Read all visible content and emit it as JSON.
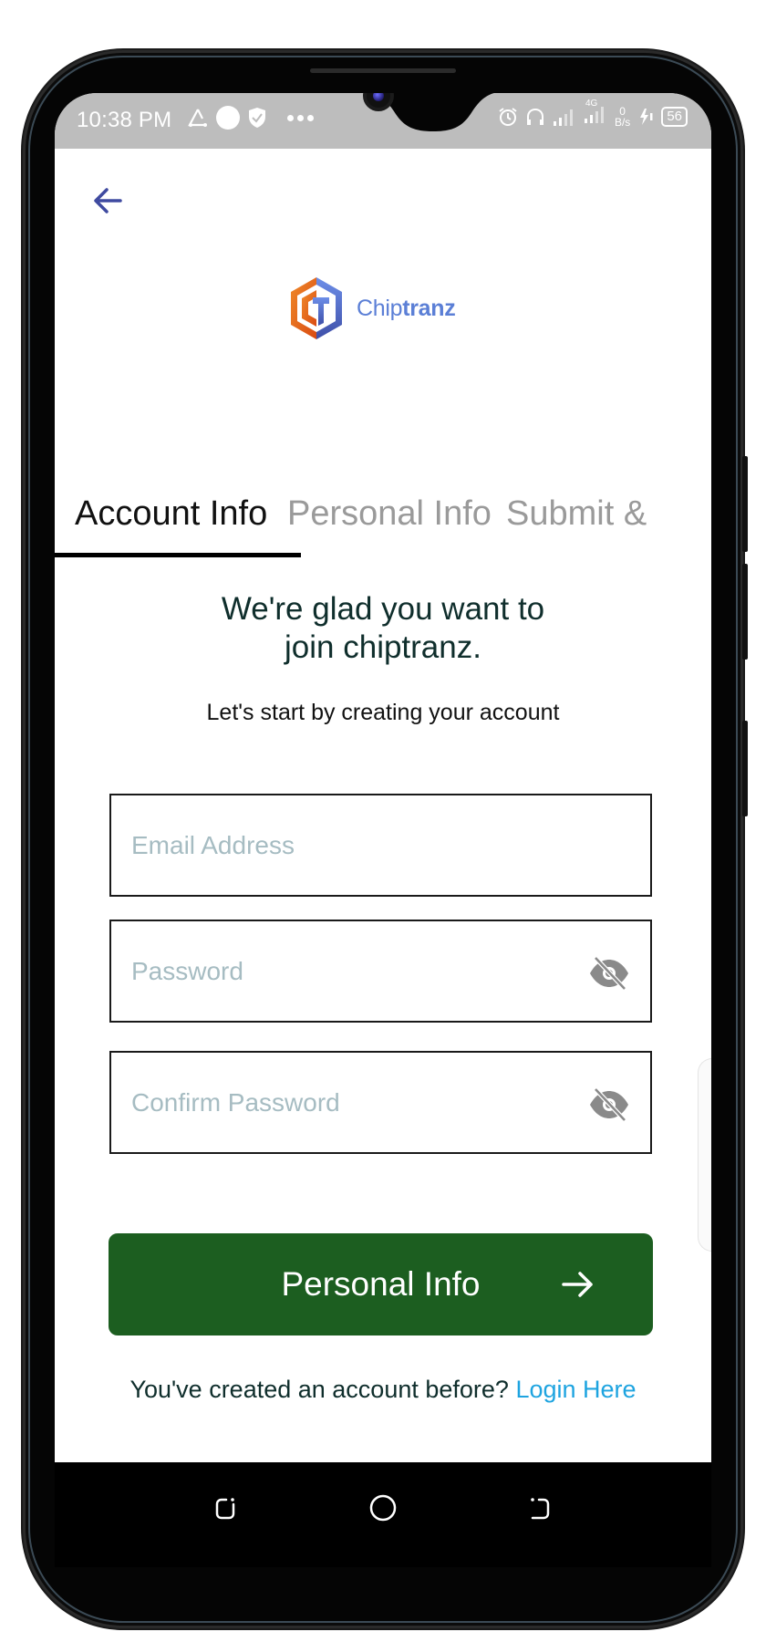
{
  "status_bar": {
    "time": "10:38 PM",
    "left_icons": [
      "triangle-icon",
      "circle-icon",
      "shield-check-icon",
      "more-dots-icon"
    ],
    "right_icons": [
      "alarm-icon",
      "headphones-icon",
      "signal-icon",
      "signal-4g-icon"
    ],
    "network_type": "4G",
    "net_speed_value": "0",
    "net_speed_unit": "B/s",
    "battery_level": "56",
    "charging": true
  },
  "header": {
    "back_label": "Back"
  },
  "logo": {
    "name_regular": "Chip",
    "name_bold": "tranz",
    "colors": {
      "orange": "#e8661c",
      "blue": "#5b7fd6"
    }
  },
  "tabs": [
    {
      "label": "Account Info",
      "active": true
    },
    {
      "label": "Personal Info",
      "active": false
    },
    {
      "label": "Submit &",
      "active": false
    }
  ],
  "main": {
    "heading_line1": "We're glad you want to",
    "heading_line2": "join chiptranz.",
    "subheading": "Let's start by creating your account"
  },
  "form": {
    "email": {
      "placeholder": "Email Address",
      "value": ""
    },
    "password": {
      "placeholder": "Password",
      "value": ""
    },
    "confirm_password": {
      "placeholder": "Confirm Password",
      "value": ""
    }
  },
  "primary_button": {
    "label": "Personal Info",
    "color": "#1c5e20"
  },
  "footer": {
    "prompt": "You've created an account before?",
    "link_label": "Login Here",
    "link_color": "#1ea4e0"
  },
  "nav_bar": {
    "buttons": [
      "recents",
      "home",
      "back"
    ]
  }
}
